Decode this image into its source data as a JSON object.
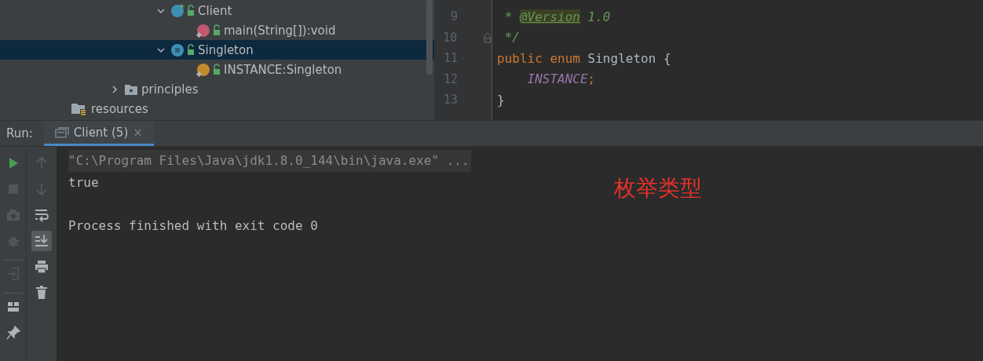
{
  "project_tree": {
    "items": [
      {
        "children": [
          {
            "children": [
              {
                "label": "Client",
                "kind": "class",
                "expanded": true,
                "selected": false,
                "children": [
                  {
                    "label": "main(String[]):void",
                    "kind": "method",
                    "selected": false
                  }
                ]
              },
              {
                "label": "Singleton",
                "kind": "enum",
                "expanded": true,
                "selected": true,
                "children": [
                  {
                    "label": "INSTANCE:Singleton",
                    "kind": "field",
                    "selected": false
                  }
                ]
              }
            ]
          },
          {
            "label": "principles",
            "kind": "package",
            "expanded": false,
            "selected": false
          }
        ]
      },
      {
        "label": "resources",
        "kind": "folder",
        "selected": false
      }
    ]
  },
  "editor": {
    "lines": [
      {
        "number": "9",
        "tokens": [
          {
            "text": " * ",
            "kind": "comment"
          },
          {
            "text": "@Version",
            "kind": "annotation"
          },
          {
            "text": " 1.0",
            "kind": "comment"
          }
        ]
      },
      {
        "number": "10",
        "fold": true,
        "tokens": [
          {
            "text": " */",
            "kind": "comment"
          }
        ]
      },
      {
        "number": "11",
        "tokens": [
          {
            "text": "public",
            "kind": "keyword"
          },
          {
            "text": " enum",
            "kind": "keyword"
          },
          {
            "text": " Singleton {",
            "kind": "plain"
          }
        ]
      },
      {
        "number": "12",
        "tokens": [
          {
            "text": "    INSTANCE",
            "kind": "constant"
          },
          {
            "text": ";",
            "kind": "punct"
          }
        ]
      },
      {
        "number": "13",
        "tokens": [
          {
            "text": "}",
            "kind": "plain"
          }
        ]
      }
    ]
  },
  "run_panel": {
    "label": "Run:",
    "tabs": [
      {
        "label": "Client (5)",
        "close": "×",
        "selected": true
      }
    ],
    "left_toolbar": [
      {
        "kind": "run",
        "disabled": false
      },
      {
        "kind": "stop",
        "disabled": true
      },
      {
        "kind": "camera",
        "disabled": true
      },
      {
        "kind": "bug",
        "disabled": true
      },
      {
        "kind": "exit",
        "disabled": true
      },
      {
        "kind": "layout",
        "disabled": false
      },
      {
        "kind": "pin",
        "disabled": false
      }
    ],
    "right_toolbar": [
      {
        "kind": "up",
        "disabled": true,
        "selected": false
      },
      {
        "kind": "down",
        "disabled": true,
        "selected": false
      },
      {
        "kind": "wrap",
        "disabled": false,
        "selected": false
      },
      {
        "kind": "scroll",
        "disabled": false,
        "selected": true
      },
      {
        "kind": "print",
        "disabled": false,
        "selected": false
      },
      {
        "kind": "trash",
        "disabled": false,
        "selected": false
      }
    ],
    "console": [
      {
        "text": "\"C:\\Program Files\\Java\\jdk1.8.0_144\\bin\\java.exe\" ...",
        "kind": "command"
      },
      {
        "text": "true",
        "kind": "output"
      },
      {
        "kind": "blank"
      },
      {
        "text": "Process finished with exit code 0",
        "kind": "output"
      }
    ],
    "annotation": "枚举类型"
  }
}
